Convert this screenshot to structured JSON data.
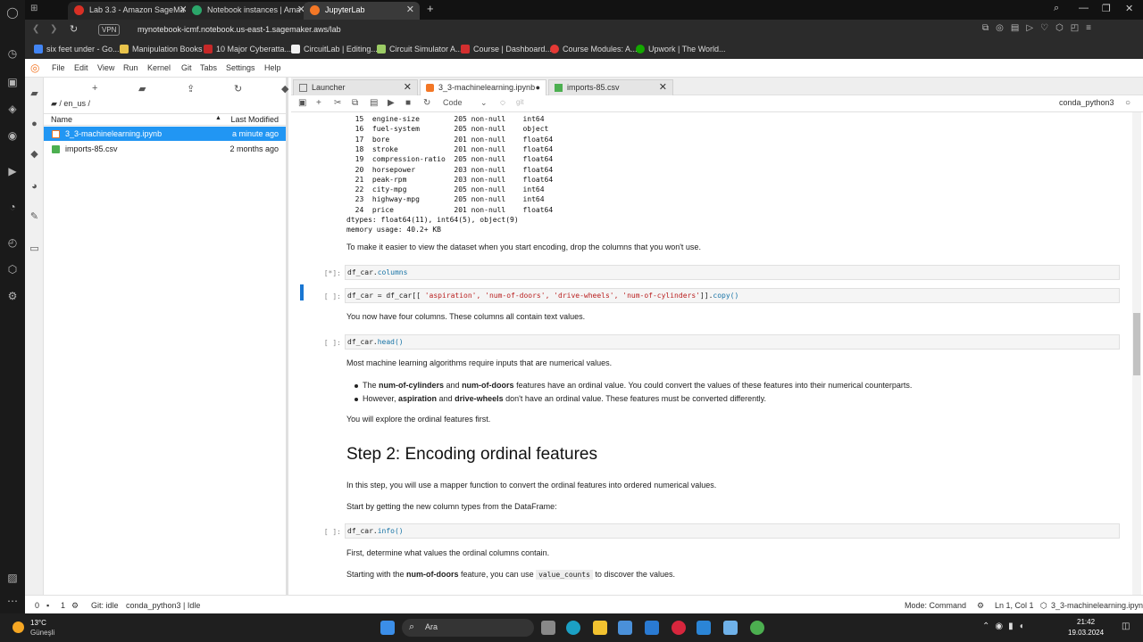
{
  "browser": {
    "tabs": [
      {
        "title": "Lab 3.3 - Amazon SageMa",
        "color": "#d93025"
      },
      {
        "title": "Notebook instances | Ama",
        "color": "#2ba66a"
      },
      {
        "title": "JupyterLab",
        "color": "#f37726"
      }
    ],
    "vpn": "VPN",
    "url": "mynotebook-icmf.notebook.us-east-1.sagemaker.aws/lab",
    "bookmarks": [
      "six feet under - Go...",
      "Manipulation Books",
      "10 Major Cyberatta...",
      "CircuitLab | Editing...",
      "Circuit Simulator A...",
      "Course | Dashboard...",
      "Course Modules: A...",
      "Upwork | The World..."
    ]
  },
  "menu": [
    "File",
    "Edit",
    "View",
    "Run",
    "Kernel",
    "Git",
    "Tabs",
    "Settings",
    "Help"
  ],
  "filebrowser": {
    "breadcrumb": "/ en_us /",
    "col_name": "Name",
    "col_modified": "Last Modified",
    "files": [
      {
        "name": "3_3-machinelearning.ipynb",
        "modified": "a minute ago",
        "selected": true
      },
      {
        "name": "imports-85.csv",
        "modified": "2 months ago",
        "selected": false
      }
    ]
  },
  "doctabs": [
    "Launcher",
    "3_3-machinelearning.ipynb",
    "imports-85.csv"
  ],
  "toolbar": {
    "cell_type": "Code",
    "git": "git",
    "kernel": "conda_python3"
  },
  "notebook": {
    "info_rows": [
      "  15  engine-size        205 non-null    int64",
      "  16  fuel-system        205 non-null    object",
      "  17  bore               201 non-null    float64",
      "  18  stroke             201 non-null    float64",
      "  19  compression-ratio  205 non-null    float64",
      "  20  horsepower         203 non-null    float64",
      "  21  peak-rpm           203 non-null    float64",
      "  22  city-mpg           205 non-null    int64",
      "  23  highway-mpg        205 non-null    int64",
      "  24  price              201 non-null    float64",
      "dtypes: float64(11), int64(5), object(9)",
      "memory usage: 40.2+ KB"
    ],
    "md1": "To make it easier to view the dataset when you start encoding, drop the columns that you won't use.",
    "cell1_prompt": "[*]:",
    "cell1_obj": "df_car.",
    "cell1_attr": "columns",
    "cell2_prompt": "[ ]:",
    "cell2_pre": "df_car = df_car[[ ",
    "cell2_strs": "'aspiration', 'num-of-doors',  'drive-wheels',  'num-of-cylinders'",
    "cell2_post": "]].",
    "cell2_attr": "copy()",
    "md2": "You now have four columns. These columns all contain text values.",
    "cell3_prompt": "[ ]:",
    "cell3_obj": "df_car.",
    "cell3_attr": "head()",
    "md3": "Most machine learning algorithms require inputs that are numerical values.",
    "b1_pre": "The ",
    "b1_bold1": "num-of-cylinders",
    "b1_mid": " and ",
    "b1_bold2": "num-of-doors",
    "b1_post": " features have an ordinal value. You could convert the values of these features into their numerical counterparts.",
    "b2_pre": "However, ",
    "b2_bold1": "aspiration",
    "b2_mid": " and ",
    "b2_bold2": "drive-wheels",
    "b2_post": " don't have an ordinal value. These features must be converted differently.",
    "md4": "You will explore the ordinal features first.",
    "h2": "Step 2: Encoding ordinal features",
    "md5": "In this step, you will use a mapper function to convert the ordinal features into ordered numerical values.",
    "md6": "Start by getting the new column types from the DataFrame:",
    "cell4_prompt": "[ ]:",
    "cell4_obj": "df_car.",
    "cell4_attr": "info()",
    "md7": "First, determine what values the ordinal columns contain.",
    "md8_pre": "Starting with the ",
    "md8_bold": "num-of-doors",
    "md8_mid": " feature, you can use ",
    "md8_code": "value_counts",
    "md8_post": " to discover the values."
  },
  "status": {
    "left_count": "0",
    "count2": "1",
    "git": "Git: idle",
    "kernel": "conda_python3 | Idle",
    "mode": "Mode: Command",
    "pos": "Ln 1, Col 1",
    "file": "3_3-machinelearning.ipynb"
  },
  "taskbar": {
    "temp": "13°C",
    "weather": "Güneşli",
    "search": "Ara",
    "time": "21:42",
    "date": "19.03.2024"
  }
}
